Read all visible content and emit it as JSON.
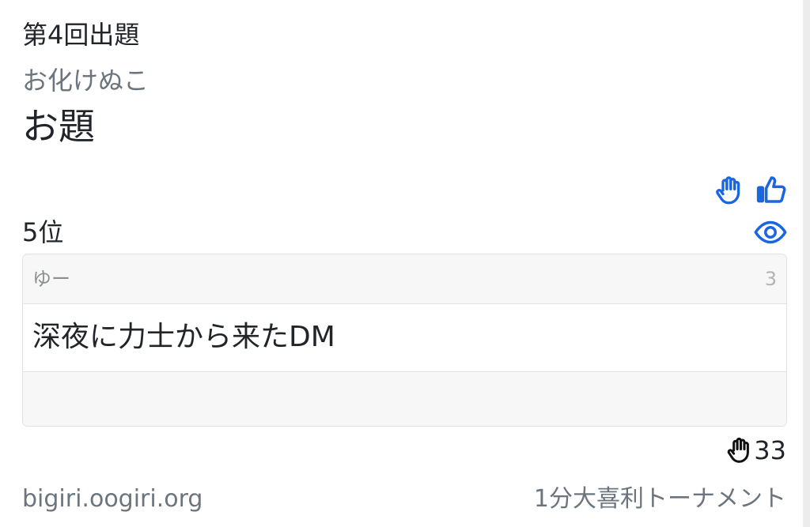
{
  "header": {
    "round_title": "第4回出題",
    "author": "お化けぬこ",
    "topic": "お題"
  },
  "icons": {
    "raise_hand": "raised-hand-icon",
    "like": "thumbs-up-icon",
    "view": "eye-icon",
    "accent_color": "#1a66e0"
  },
  "answer": {
    "rank": "5位",
    "answerer": "ゆー",
    "answer_id": "3",
    "text": "深夜に力士から来たDM",
    "vote_count": "33"
  },
  "footer": {
    "site": "bigiri.oogiri.org",
    "tournament": "1分大喜利トーナメント"
  }
}
